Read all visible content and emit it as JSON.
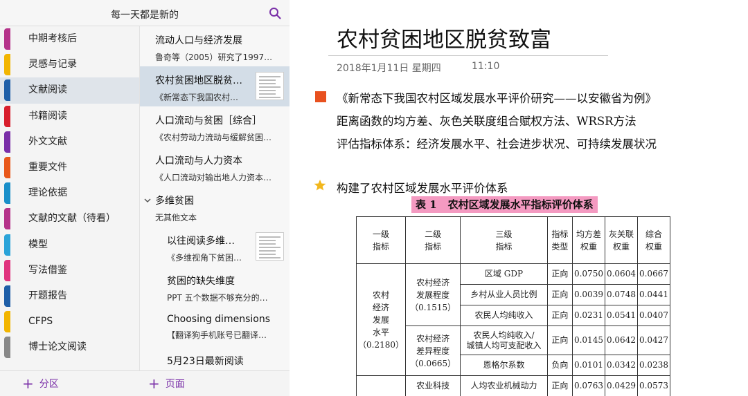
{
  "notebook": {
    "title": "每一天都是新的"
  },
  "sections": [
    {
      "label": "中期考核后",
      "color": "#b5338a"
    },
    {
      "label": "灵感与记录",
      "color": "#f2b500"
    },
    {
      "label": "文献阅读",
      "color": "#1f5fa8",
      "active": true
    },
    {
      "label": "书籍阅读",
      "color": "#d81e2c"
    },
    {
      "label": "外文文献",
      "color": "#7a2fa8"
    },
    {
      "label": "重要文件",
      "color": "#e8581a"
    },
    {
      "label": "理论依据",
      "color": "#1a8fc9"
    },
    {
      "label": "文献的文献（待看）",
      "color": "#b5338a"
    },
    {
      "label": "模型",
      "color": "#2ba4d9"
    },
    {
      "label": "写法借鉴",
      "color": "#e0337e"
    },
    {
      "label": "开题报告",
      "color": "#1f5fa8"
    },
    {
      "label": "CFPS",
      "color": "#f2b500"
    },
    {
      "label": "博士论文阅读",
      "color": "#888888"
    }
  ],
  "pages": [
    {
      "title": "流动人口与经济发展",
      "snippet": "鲁奇等（2005）研究了1997…"
    },
    {
      "title": "农村贫困地区脱贫…",
      "snippet": "《新常态下我国农村…",
      "active": true
    },
    {
      "title": "人口流动与贫困［综合］",
      "snippet": "《农村劳动力流动与缓解贫困…"
    },
    {
      "title": "人口流动与人力资本",
      "snippet": "《人口流动对输出地人力资本…"
    },
    {
      "title": "多维贫困",
      "snippet": "无其他文本"
    },
    {
      "title": "以往阅读多维…",
      "snippet": "《多维视角下贫困…"
    },
    {
      "title": "贫困的缺失维度",
      "snippet": "PPT  五个数据不够充分的…"
    },
    {
      "title": "Choosing dimensions",
      "snippet": "【翻译狗手机账号已翻译…"
    },
    {
      "title": "5月23日最新阅读",
      "snippet": ""
    }
  ],
  "bottom": {
    "add_section": "分区",
    "add_page": "页面"
  },
  "note": {
    "title": "农村贫困地区脱贫致富",
    "date": "2018年1月11日 星期四",
    "time": "11:10",
    "line1": "《新常态下我国农村区域发展水平评价研究——以安徽省为例》",
    "line2": "距离函数的均方差、灰色关联度组合赋权方法、WRSR方法",
    "line3": "评估指标体系：经济发展水平、社会进步状况、可持续发展状况",
    "line4": "构建了农村区域发展水平评价体系",
    "table_caption_no": "表 1",
    "table_caption": "农村区域发展水平指标评价体系",
    "accent_square": "#e8511f",
    "accent_star": "#f2b71c",
    "caption_highlight": "#f49ac1"
  },
  "table": {
    "headers": [
      "一级\n指标",
      "二级\n指标",
      "三级\n指标",
      "指标\n类型",
      "均方差\n权重",
      "灰关联\n权重",
      "综合\n权重"
    ],
    "level1": "农村\n经济\n发展\n水平\n（0.2180）",
    "groupA": "农村经济\n发展程度\n（0.1515）",
    "groupB": "农村经济\n差异程度\n（0.0665）",
    "groupC": "农业科技",
    "rows": [
      [
        "区域 GDP",
        "正向",
        "0.0750",
        "0.0604",
        "0.0667"
      ],
      [
        "乡村从业人员比例",
        "正向",
        "0.0039",
        "0.0748",
        "0.0441"
      ],
      [
        "农民人均纯收入",
        "正向",
        "0.0231",
        "0.0541",
        "0.0407"
      ],
      [
        "农民人均纯收入/\n城镇人均可支配收入",
        "正向",
        "0.0145",
        "0.0642",
        "0.0427"
      ],
      [
        "恩格尔系数",
        "负向",
        "0.0101",
        "0.0342",
        "0.0238"
      ],
      [
        "人均农业机械动力",
        "正向",
        "0.0763",
        "0.0429",
        "0.0573"
      ]
    ]
  }
}
